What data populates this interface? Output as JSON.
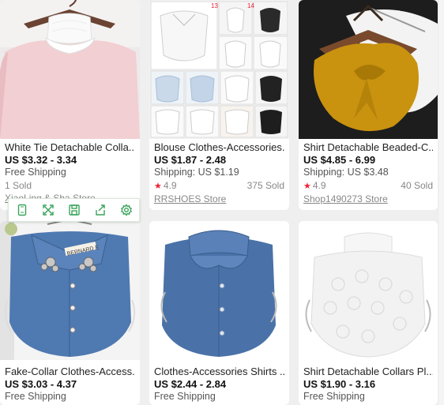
{
  "products": [
    {
      "title": "White Tie Detachable Colla...",
      "price": "US $3.32 - 3.34",
      "shipping": "Free Shipping",
      "sold_left": "1 Sold",
      "rating": "",
      "sold_right": "",
      "store": "XiaoLing & Sha Store"
    },
    {
      "title": "Blouse Clothes-Accessories...",
      "price": "US $1.87 - 2.48",
      "shipping": "Shipping: US $1.19",
      "rating": "4.9",
      "sold_right": "375 Sold",
      "store": "RRSHOES Store",
      "thumb_numbers": [
        "13",
        "14"
      ]
    },
    {
      "title": "Shirt Detachable Beaded-C...",
      "price": "US $4.85 - 6.99",
      "shipping": "Shipping: US $3.48",
      "rating": "4.9",
      "sold_right": "40 Sold",
      "store": "Shop1490273 Store"
    },
    {
      "title": "Fake-Collar Clothes-Access...",
      "price": "US $3.03 - 4.37",
      "shipping": "Free Shipping",
      "collar_label": "BERNARD E"
    },
    {
      "title": "Clothes-Accessories Shirts ...",
      "price": "US $2.44 - 2.84",
      "shipping": "Free Shipping"
    },
    {
      "title": "Shirt Detachable Collars Pl...",
      "price": "US $1.90 - 3.16",
      "shipping": "Free Shipping"
    }
  ],
  "toolbar": {
    "icons": [
      "phone-icon",
      "expand-icon",
      "save-icon",
      "share-icon",
      "settings-icon"
    ],
    "color": "#3aa35b"
  },
  "colors": {
    "star": "#e22233",
    "pink": "#f1cfd2",
    "denim": "#4f79b1",
    "mustard": "#c9920f"
  }
}
